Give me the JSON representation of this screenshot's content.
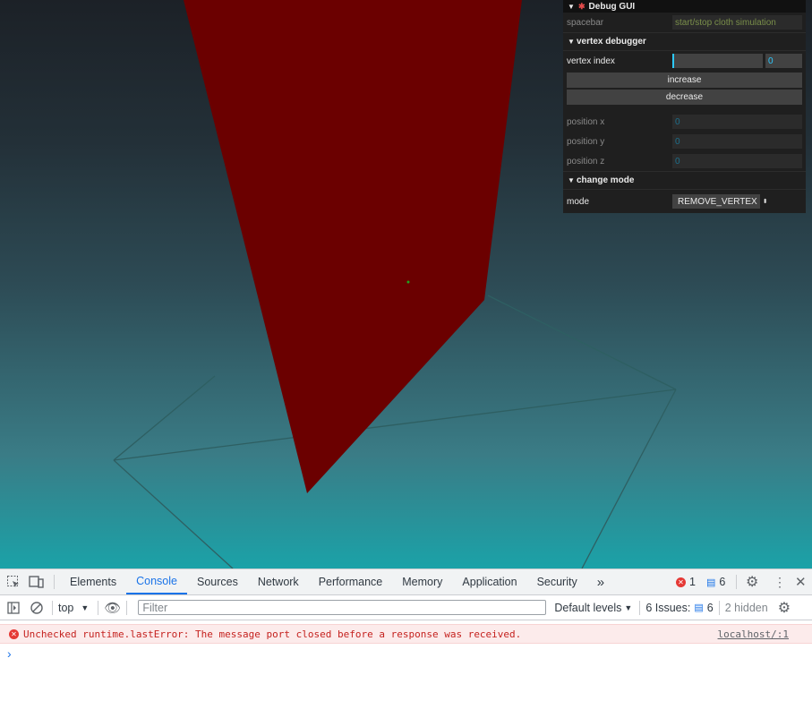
{
  "gui": {
    "title": "Debug GUI",
    "spacebar": {
      "label": "spacebar",
      "value": "start/stop cloth simulation"
    },
    "vertex_folder": {
      "title": "vertex debugger",
      "vertex_index_label": "vertex index",
      "vertex_index_value": "0",
      "increase_label": "increase",
      "decrease_label": "decrease",
      "position_x_label": "position x",
      "position_x_value": "0",
      "position_y_label": "position y",
      "position_y_value": "0",
      "position_z_label": "position z",
      "position_z_value": "0"
    },
    "mode_folder": {
      "title": "change mode",
      "mode_label": "mode",
      "mode_value": "REMOVE_VERTEX"
    }
  },
  "devtools": {
    "tabs": [
      "Elements",
      "Console",
      "Sources",
      "Network",
      "Performance",
      "Memory",
      "Application",
      "Security"
    ],
    "active_tab": "Console",
    "more_tabs": "»",
    "error_count": "1",
    "message_count": "6",
    "context": "top",
    "filter_placeholder": "Filter",
    "levels": "Default levels",
    "issues_label": "6 Issues:",
    "issues_count": "6",
    "hidden": "2 hidden",
    "error_message": "Unchecked runtime.lastError: The message port closed before a response was received.",
    "error_source": "localhost/:1",
    "prompt": "›"
  },
  "colors": {
    "cloth": "#6b0000",
    "gui_bg": "#1f1f1f",
    "accent": "#1a73e8",
    "error": "#e53935"
  }
}
